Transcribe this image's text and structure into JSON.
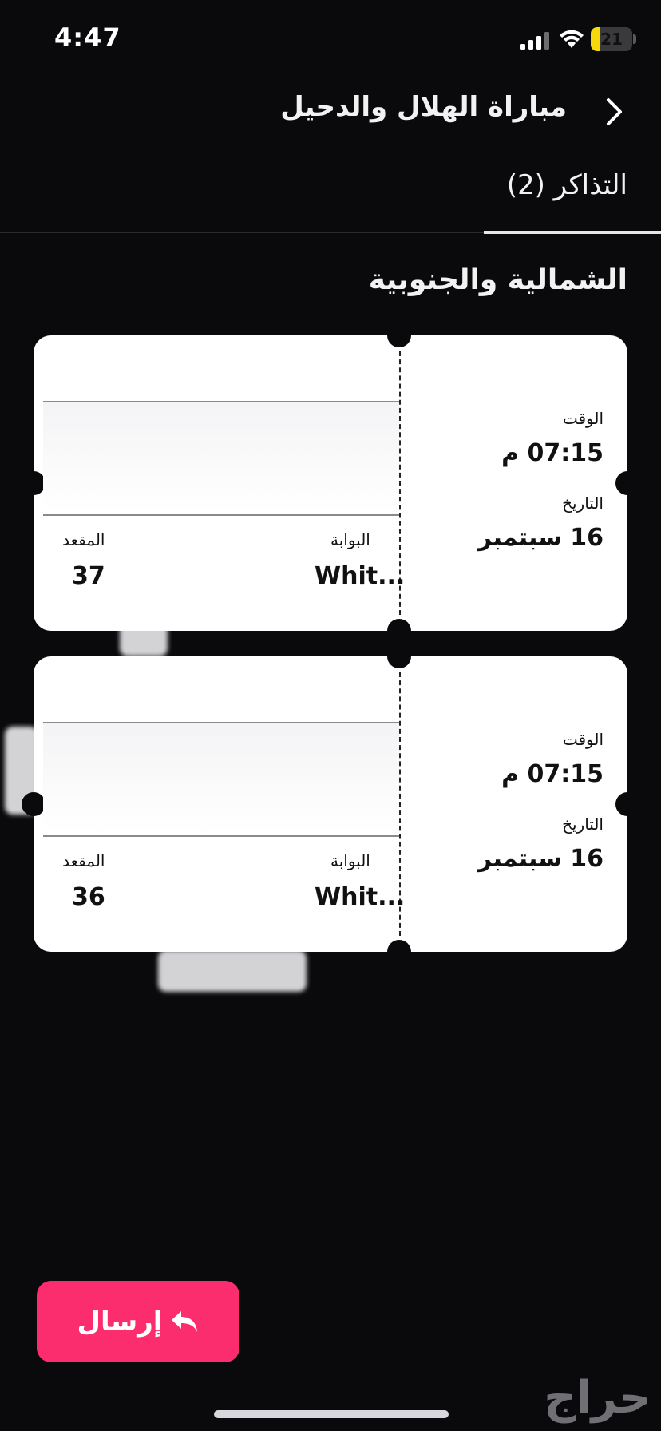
{
  "status_bar": {
    "time": "4:47",
    "battery_percent": "21",
    "battery_level": 0.21
  },
  "header": {
    "title": "مباراة الهلال والدحيل"
  },
  "tabs": [
    {
      "label": "التذاكر (2)",
      "selected": true
    }
  ],
  "section": {
    "title": "الشمالية والجنوبية"
  },
  "tickets": [
    {
      "time_label": "الوقت",
      "time_value": "07:15 م",
      "date_label": "التاريخ",
      "date_value": "16 سبتمبر",
      "gate_label": "البوابة",
      "gate_value": "Whit...",
      "seat_label": "المقعد",
      "seat_value": "37"
    },
    {
      "time_label": "الوقت",
      "time_value": "07:15 م",
      "date_label": "التاريخ",
      "date_value": "16 سبتمبر",
      "gate_label": "البوابة",
      "gate_value": "Whit...",
      "seat_label": "المقعد",
      "seat_value": "36"
    }
  ],
  "actions": {
    "send_label": "إرسال"
  },
  "watermark": "حراج",
  "colors": {
    "accent": "#fb2d6e",
    "background": "#0a0a0c",
    "battery": "#f5d90a"
  }
}
